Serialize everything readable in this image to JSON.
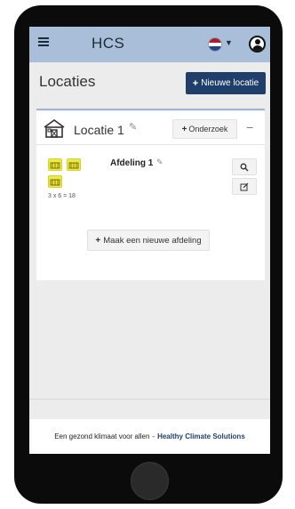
{
  "navbar": {
    "brand": "HCS",
    "menu_icon": "hamburger-icon",
    "language_flag": "netherlands-flag-icon",
    "user_icon": "user-circle-icon",
    "colors": {
      "navbar_bg": "#a9bfd9",
      "primary": "#1f3f6a",
      "cage_yellow": "#ece94a"
    }
  },
  "header": {
    "title": "Locaties",
    "new_location_label": "Nieuwe locatie"
  },
  "location": {
    "name": "Locatie 1",
    "research_label": "Onderzoek",
    "collapse_symbol": "−",
    "department": {
      "name": "Afdeling 1",
      "cage_count_text": "3 x 6 = 18"
    },
    "new_department_label": "Maak een nieuwe afdeling"
  },
  "footer": {
    "text": "Een gezond klimaat voor allen",
    "separator": "-",
    "link": "Healthy Climate Solutions"
  }
}
